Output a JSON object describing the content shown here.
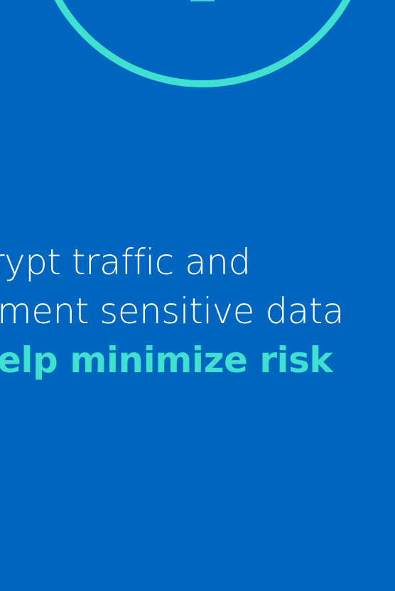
{
  "headline": {
    "line1": "rypt traffic and",
    "line2": "ment sensitive data",
    "line3": "elp minimize risk"
  },
  "colors": {
    "background": "#0066BF",
    "accent": "#3FE0D0",
    "text": "#FFFFFF"
  },
  "icons": {
    "ring": "circle-outline-icon"
  }
}
